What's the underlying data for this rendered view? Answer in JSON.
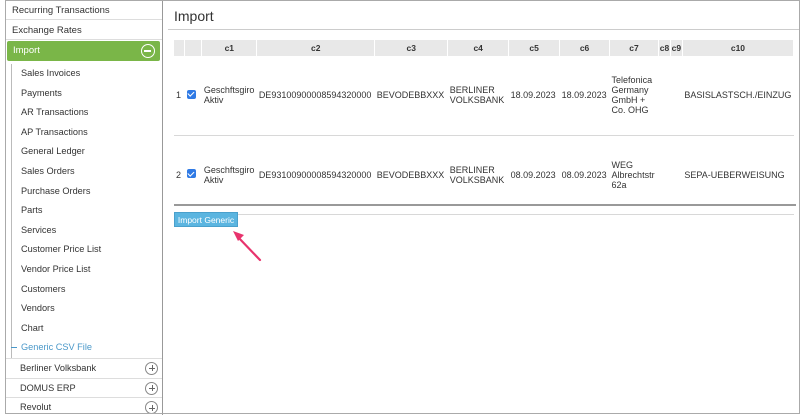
{
  "sidebar": {
    "top_items": [
      "Recurring Transactions",
      "Exchange Rates"
    ],
    "active_label": "Import",
    "sub_items": [
      "Sales Invoices",
      "Payments",
      "AR Transactions",
      "AP Transactions",
      "General Ledger",
      "Sales Orders",
      "Purchase Orders",
      "Parts",
      "Services",
      "Customer Price List",
      "Vendor Price List",
      "Customers",
      "Vendors",
      "Chart"
    ],
    "current_item": "Generic CSV File",
    "groups": [
      "Berliner Volksbank",
      "DOMUS ERP",
      "Revolut"
    ]
  },
  "main": {
    "title": "Import",
    "columns": [
      "c1",
      "c2",
      "c3",
      "c4",
      "c5",
      "c6",
      "c7",
      "c8",
      "c9",
      "c10"
    ],
    "rows": [
      {
        "num": "1",
        "c1": "Geschftsgiro Aktiv",
        "c2": "DE93100900008594320000",
        "c3": "BEVODEBBXXX",
        "c4": "BERLINER VOLKSBANK",
        "c5": "18.09.2023",
        "c6": "18.09.2023",
        "c7": "Telefonica Germany GmbH + Co. OHG",
        "c8": "",
        "c9": "",
        "c10": "BASISLASTSCH./EINZUG"
      },
      {
        "num": "2",
        "c1": "Geschftsgiro Aktiv",
        "c2": "DE93100900008594320000",
        "c3": "BEVODEBBXXX",
        "c4": "BERLINER VOLKSBANK",
        "c5": "08.09.2023",
        "c6": "08.09.2023",
        "c7": "WEG Albrechtstr 62a",
        "c8": "",
        "c9": "",
        "c10": "SEPA-UEBERWEISUNG"
      }
    ],
    "import_button": "Import Generic"
  },
  "colors": {
    "active": "#7ab648",
    "button": "#5bb5e0",
    "arrow": "#e8336d",
    "link": "#4a98c9"
  }
}
